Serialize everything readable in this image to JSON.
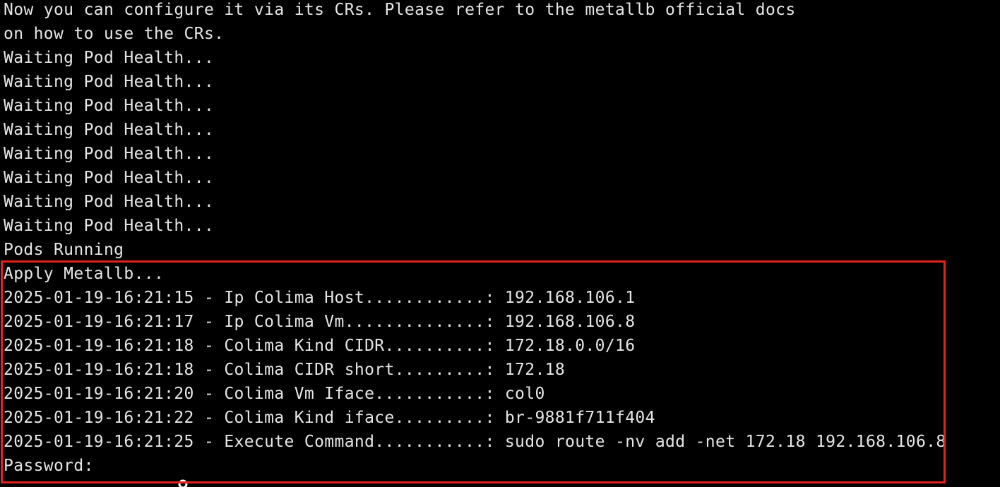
{
  "terminal": {
    "lines": [
      "Now you can configure it via its CRs. Please refer to the metallb official docs",
      "on how to use the CRs.",
      "Waiting Pod Health...",
      "Waiting Pod Health...",
      "Waiting Pod Health...",
      "Waiting Pod Health...",
      "Waiting Pod Health...",
      "Waiting Pod Health...",
      "Waiting Pod Health...",
      "Waiting Pod Health...",
      "Pods Running",
      "Apply Metallb...",
      "2025-01-19-16:21:15 - Ip Colima Host............: 192.168.106.1",
      "2025-01-19-16:21:17 - Ip Colima Vm..............: 192.168.106.8",
      "2025-01-19-16:21:18 - Colima Kind CIDR..........: 172.18.0.0/16",
      "2025-01-19-16:21:18 - Colima CIDR short.........: 172.18",
      "2025-01-19-16:21:20 - Colima Vm Iface...........: col0",
      "2025-01-19-16:21:22 - Colima Kind iface.........: br-9881f711f404",
      "2025-01-19-16:21:25 - Execute Command...........: sudo route -nv add -net 172.18 192.168.106.8"
    ],
    "password_prompt": "Password:",
    "password_icon": "key-icon",
    "highlight_color": "#e0231e",
    "text_color": "#e6e6e6",
    "background_color": "#000000"
  }
}
